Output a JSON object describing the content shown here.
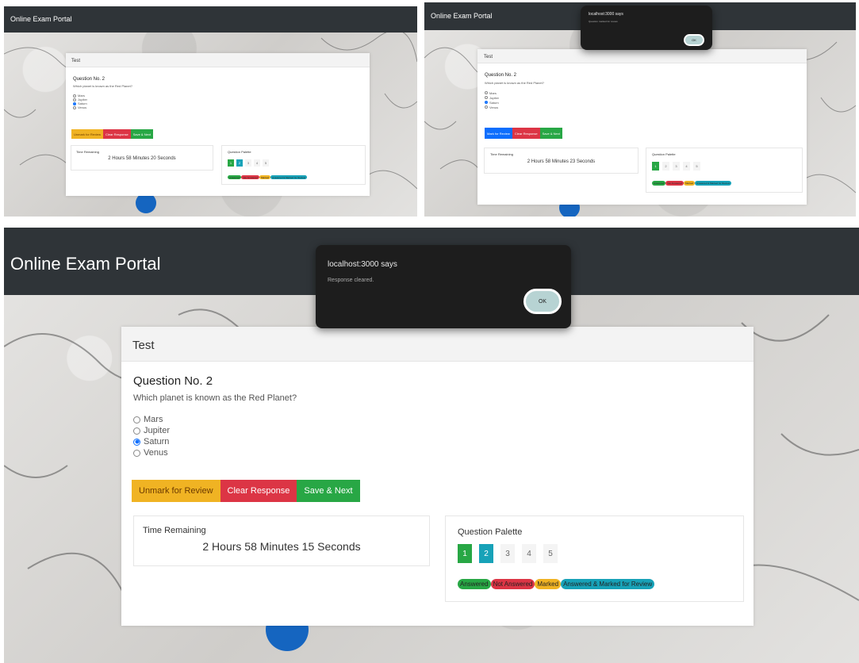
{
  "brand": "Online Exam Portal",
  "card_header": "Test",
  "question": {
    "title": "Question No. 2",
    "text": "Which planet is known as the Red Planet?",
    "options": [
      "Mars",
      "Jupiter",
      "Saturn",
      "Venus"
    ],
    "selected_index": 2
  },
  "buttons": {
    "unmark": "Unmark for Review",
    "mark": "Mark for Review",
    "clear": "Clear Response",
    "save_next": "Save & Next"
  },
  "timer": {
    "label": "Time Remaining",
    "shot1": "2 Hours 58 Minutes 20 Seconds",
    "shot2": "2 Hours 58 Minutes 23 Seconds",
    "shot3": "2 Hours 58 Minutes 15 Seconds"
  },
  "palette": {
    "label": "Question Palette",
    "numbers": [
      "1",
      "2",
      "3",
      "4",
      "5"
    ],
    "legend": [
      "Answered",
      "Not Answered",
      "Marked",
      "Answered & Marked for Review"
    ]
  },
  "dialog": {
    "title": "localhost:3000 says",
    "message_shot2": "Question marked for review",
    "message_shot3": "Response cleared.",
    "ok": "OK"
  },
  "colors": {
    "navbar": "#2f3438",
    "answered": "#28a745",
    "not_answered": "#dc3545",
    "marked": "#f0b323",
    "answered_marked": "#17a2b8",
    "primary": "#0d6efd"
  }
}
